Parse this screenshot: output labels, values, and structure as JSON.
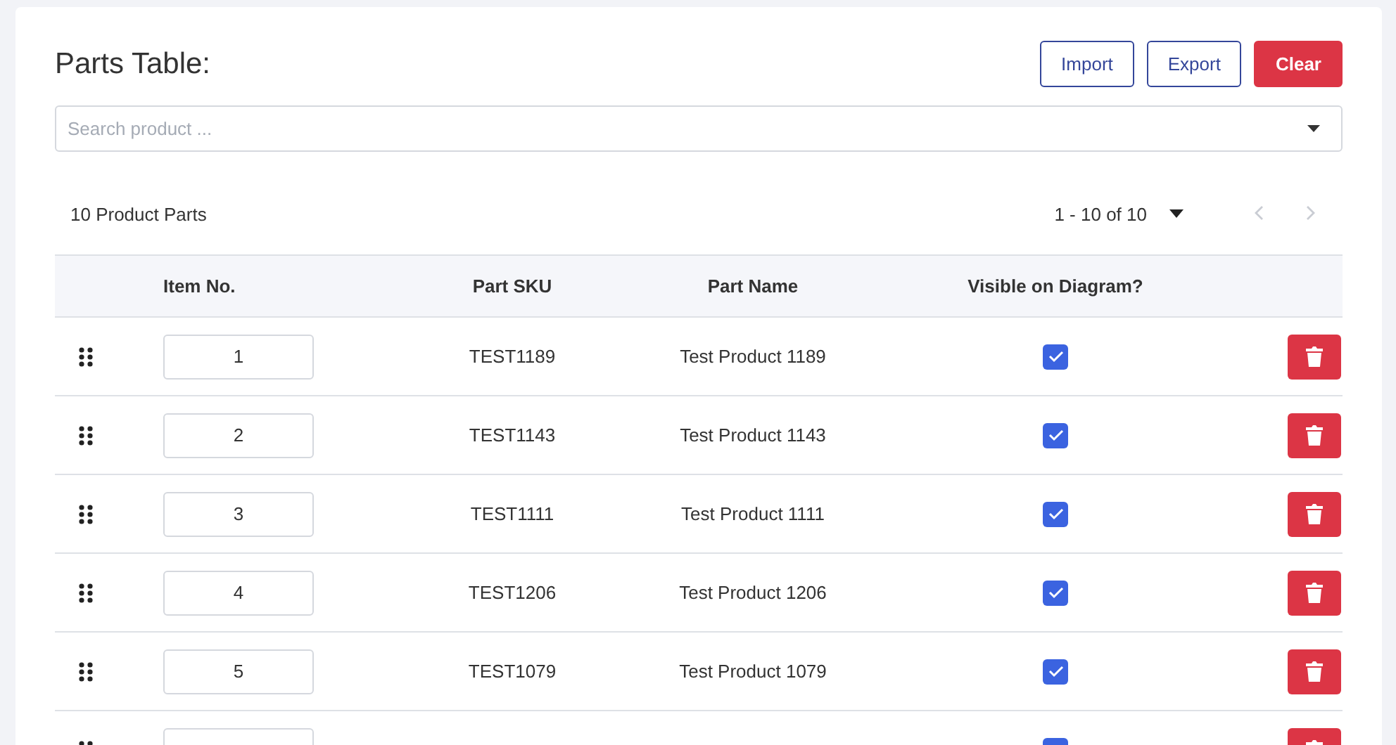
{
  "title": "Parts Table:",
  "buttons": [
    {
      "label": "Import",
      "kind": "outline"
    },
    {
      "label": "Export",
      "kind": "outline"
    },
    {
      "label": "Clear",
      "kind": "danger"
    }
  ],
  "search": {
    "placeholder": "Search product ..."
  },
  "summary": "10 Product Parts",
  "pagination": {
    "range": "1 - 10 of 10",
    "prev_disabled": true,
    "next_disabled": true
  },
  "table": {
    "columns": [
      "Item No.",
      "Part SKU",
      "Part Name",
      "Visible on Diagram?"
    ],
    "rows": [
      {
        "item_no": "1",
        "sku": "TEST1189",
        "name": "Test Product 1189",
        "visible": true
      },
      {
        "item_no": "2",
        "sku": "TEST1143",
        "name": "Test Product 1143",
        "visible": true
      },
      {
        "item_no": "3",
        "sku": "TEST1111",
        "name": "Test Product 1111",
        "visible": true
      },
      {
        "item_no": "4",
        "sku": "TEST1206",
        "name": "Test Product 1206",
        "visible": true
      },
      {
        "item_no": "5",
        "sku": "TEST1079",
        "name": "Test Product 1079",
        "visible": true
      },
      {
        "visible": true
      }
    ]
  }
}
